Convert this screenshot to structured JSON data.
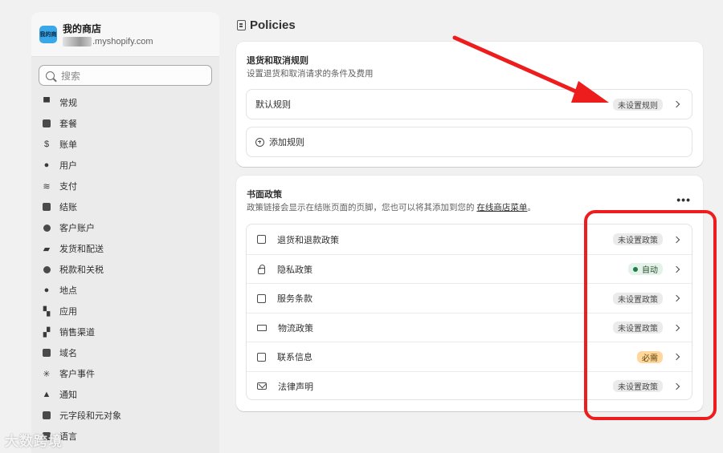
{
  "sidebar": {
    "store_logo_text": "我的商",
    "store_name": "我的商店",
    "store_domain": ".myshopify.com",
    "search_placeholder": "搜索",
    "items": [
      {
        "label": "常规",
        "icon": "store-icon"
      },
      {
        "label": "套餐",
        "icon": "plan-icon"
      },
      {
        "label": "账单",
        "icon": "billing-icon"
      },
      {
        "label": "用户",
        "icon": "users-icon"
      },
      {
        "label": "支付",
        "icon": "payments-icon"
      },
      {
        "label": "结账",
        "icon": "cart-icon"
      },
      {
        "label": "客户账户",
        "icon": "customer-icon"
      },
      {
        "label": "发货和配送",
        "icon": "shipping-icon"
      },
      {
        "label": "税款和关税",
        "icon": "tax-icon"
      },
      {
        "label": "地点",
        "icon": "location-icon"
      },
      {
        "label": "应用",
        "icon": "apps-icon"
      },
      {
        "label": "销售渠道",
        "icon": "channels-icon"
      },
      {
        "label": "域名",
        "icon": "domain-icon"
      },
      {
        "label": "客户事件",
        "icon": "events-icon"
      },
      {
        "label": "通知",
        "icon": "bell-icon"
      },
      {
        "label": "元字段和元对象",
        "icon": "metafields-icon"
      },
      {
        "label": "语言",
        "icon": "language-icon"
      }
    ]
  },
  "page": {
    "title": "Policies"
  },
  "returns_card": {
    "title": "退货和取消规则",
    "subtitle": "设置退货和取消请求的条件及费用",
    "default_rule_label": "默认规则",
    "default_rule_badge": "未设置规则",
    "add_rule_label": "添加规则"
  },
  "policies_card": {
    "title": "书面政策",
    "subtitle_prefix": "政策链接会显示在结账页面的页脚，您也可以将其添加到您的 ",
    "subtitle_link": "在线商店菜单",
    "subtitle_suffix": "。",
    "more_label": "•••",
    "rows": [
      {
        "label": "退货和退款政策",
        "badge": "未设置政策",
        "badge_type": "default",
        "icon": "refund-policy-icon"
      },
      {
        "label": "隐私政策",
        "badge": "自动",
        "badge_type": "success",
        "icon": "lock-icon"
      },
      {
        "label": "服务条款",
        "badge": "未设置政策",
        "badge_type": "default",
        "icon": "terms-icon"
      },
      {
        "label": "物流政策",
        "badge": "未设置政策",
        "badge_type": "default",
        "icon": "truck-icon"
      },
      {
        "label": "联系信息",
        "badge": "必需",
        "badge_type": "warning",
        "icon": "contact-card-icon"
      },
      {
        "label": "法律声明",
        "badge": "未设置政策",
        "badge_type": "default",
        "icon": "envelope-icon"
      }
    ]
  },
  "colors": {
    "annotation_red": "#ee1d1d",
    "badge_required": "#ffd79d",
    "badge_auto_dot": "#1e7d46"
  },
  "watermark": "大数跨境"
}
